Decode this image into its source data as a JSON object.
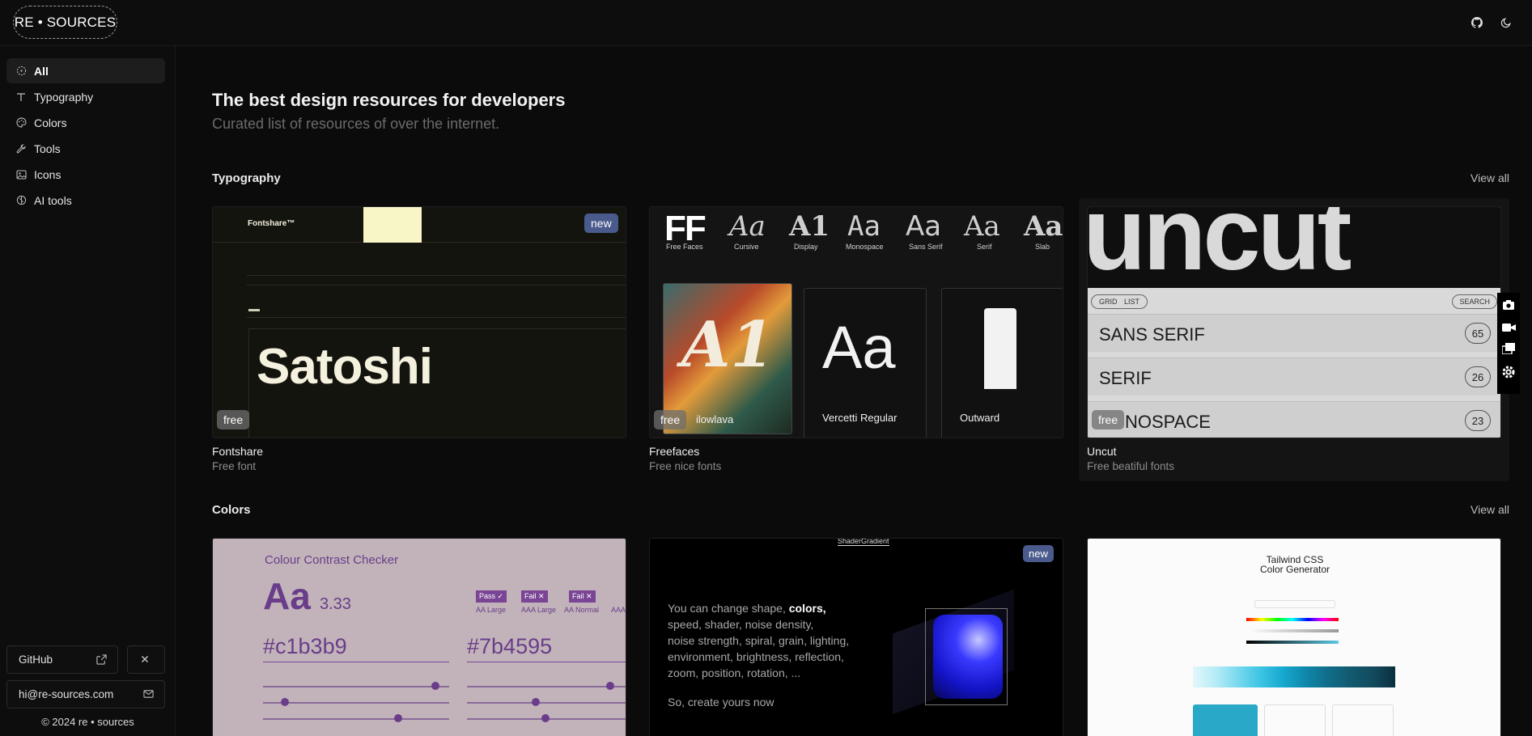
{
  "brand": {
    "logo_text": "RE • SOURCES"
  },
  "topbar": {
    "github_icon": "github-icon",
    "theme_icon": "moon-icon"
  },
  "sidebar": {
    "items": [
      {
        "label": "All",
        "icon": "dashed-circle-icon",
        "active": true
      },
      {
        "label": "Typography",
        "icon": "type-icon",
        "active": false
      },
      {
        "label": "Colors",
        "icon": "palette-icon",
        "active": false
      },
      {
        "label": "Tools",
        "icon": "wrench-icon",
        "active": false
      },
      {
        "label": "Icons",
        "icon": "image-icon",
        "active": false
      },
      {
        "label": "AI tools",
        "icon": "brain-icon",
        "active": false
      }
    ],
    "github_label": "GitHub",
    "email_label": "hi@re-sources.com",
    "copyright": "© 2024 re • sources"
  },
  "hero": {
    "title": "The best design resources for developers",
    "subtitle": "Curated list of resources of over the internet."
  },
  "sections": [
    {
      "title": "Typography",
      "view_all": "View all",
      "cards": [
        {
          "title": "Fontshare",
          "subtitle": "Free font",
          "tags": [
            "free",
            "new"
          ],
          "preview_word": "Satoshi",
          "preview_logo": "Fontshare™"
        },
        {
          "title": "Freefaces",
          "subtitle": "Free nice fonts",
          "tags": [
            "free"
          ],
          "preview_logo": "FF",
          "preview_caption": "Free Faces",
          "samples": [
            "Cursive",
            "Display",
            "Monospace",
            "Sans Serif",
            "Serif",
            "Slab"
          ],
          "panel_labels": [
            "ilowlava",
            "Vercetti Regular",
            "Outward"
          ],
          "panel_glyph": "Aa"
        },
        {
          "title": "Uncut",
          "subtitle": "Free beatiful fonts",
          "tags": [
            "free"
          ],
          "rows": [
            {
              "label": "SANS SERIF",
              "count": "65"
            },
            {
              "label": "SERIF",
              "count": "26"
            },
            {
              "label": "NOSPACE",
              "count": "23"
            }
          ],
          "toggle": [
            "GRID",
            "LIST"
          ],
          "search": "SEARCH"
        }
      ]
    },
    {
      "title": "Colors",
      "view_all": "View all",
      "cards": [
        {
          "title": "Colour Contrast Checker",
          "ratio": "3.33",
          "glyph": "Aa",
          "hex_bg": "#c1b3b9",
          "hex_fg": "#7b4595",
          "pills": [
            "Pass ✓",
            "Fail ✕",
            "Fail ✕"
          ],
          "pill_labels": [
            "AA Large",
            "AAA Large",
            "AA Normal",
            "AAA"
          ]
        },
        {
          "title": "ShaderGradient",
          "tags": [
            "new"
          ],
          "text_plain_1": "You can change shape, ",
          "text_bold": "colors,",
          "text_plain_2": "speed, shader, noise density,\nnoise strength, spiral, grain, lighting,\nenvironment, brightness, reflection,\nzoom, position, rotation, ...",
          "cta": "So, create yours now"
        },
        {
          "title": "Tailwind CSS Color Generator",
          "title_line_1": "Tailwind CSS",
          "title_line_2": "Color Generator"
        }
      ]
    }
  ],
  "colors": {
    "background": "#0b0b0b",
    "sidebar_active": "#1d1d1d",
    "tag_new": "#4a5a8c",
    "contrast_bg": "#c1b3b9",
    "contrast_fg": "#7b4595",
    "shader_blue": "#2a2cff"
  }
}
